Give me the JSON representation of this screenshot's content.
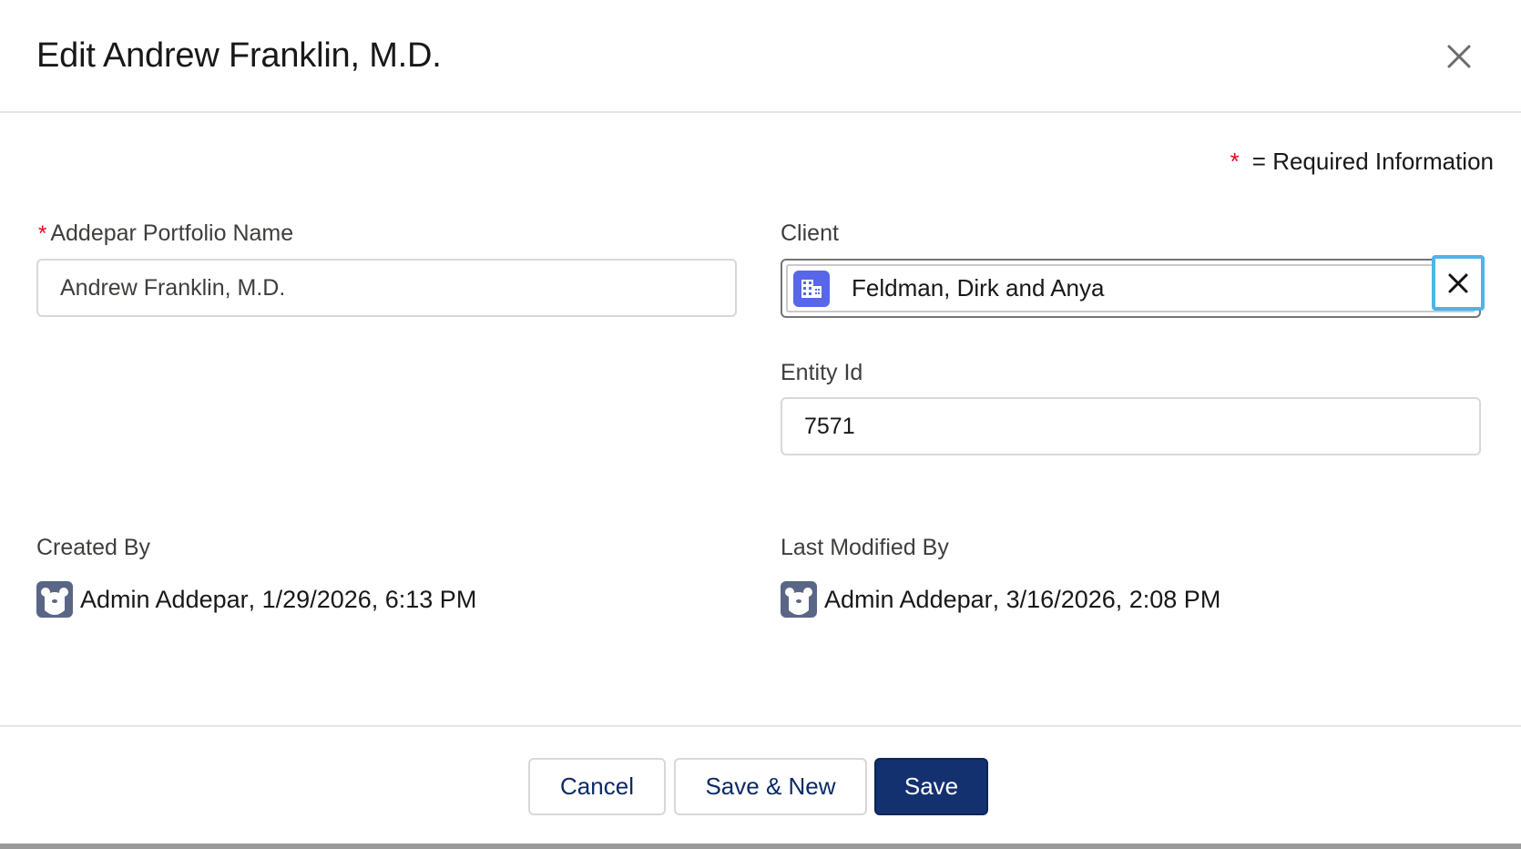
{
  "header": {
    "title": "Edit Andrew Franklin, M.D.",
    "close_icon": "close-icon"
  },
  "required_note": {
    "star": "*",
    "text": "= Required Information"
  },
  "fields": {
    "portfolio_name": {
      "label": "Addepar Portfolio Name",
      "required_marker": "*",
      "value": "Andrew Franklin, M.D."
    },
    "client": {
      "label": "Client",
      "value": "Feldman, Dirk and Anya",
      "icon": "account-building-icon",
      "clear_icon": "clear-x-icon"
    },
    "entity_id": {
      "label": "Entity Id",
      "value": "7571"
    }
  },
  "audit": {
    "created_by": {
      "label": "Created By",
      "user": "Admin Addepar",
      "timestamp": "1/29/2026, 6:13 PM"
    },
    "last_modified_by": {
      "label": "Last Modified By",
      "user": "Admin Addepar",
      "timestamp": "3/16/2026, 2:08 PM"
    }
  },
  "footer": {
    "cancel_label": "Cancel",
    "save_new_label": "Save & New",
    "save_label": "Save"
  },
  "colors": {
    "required": "#ea001e",
    "brand_button": "#14316f",
    "entity_icon_bg": "#5867e8",
    "focus_ring": "#4fb3ea",
    "avatar_bg": "#5a6686"
  }
}
